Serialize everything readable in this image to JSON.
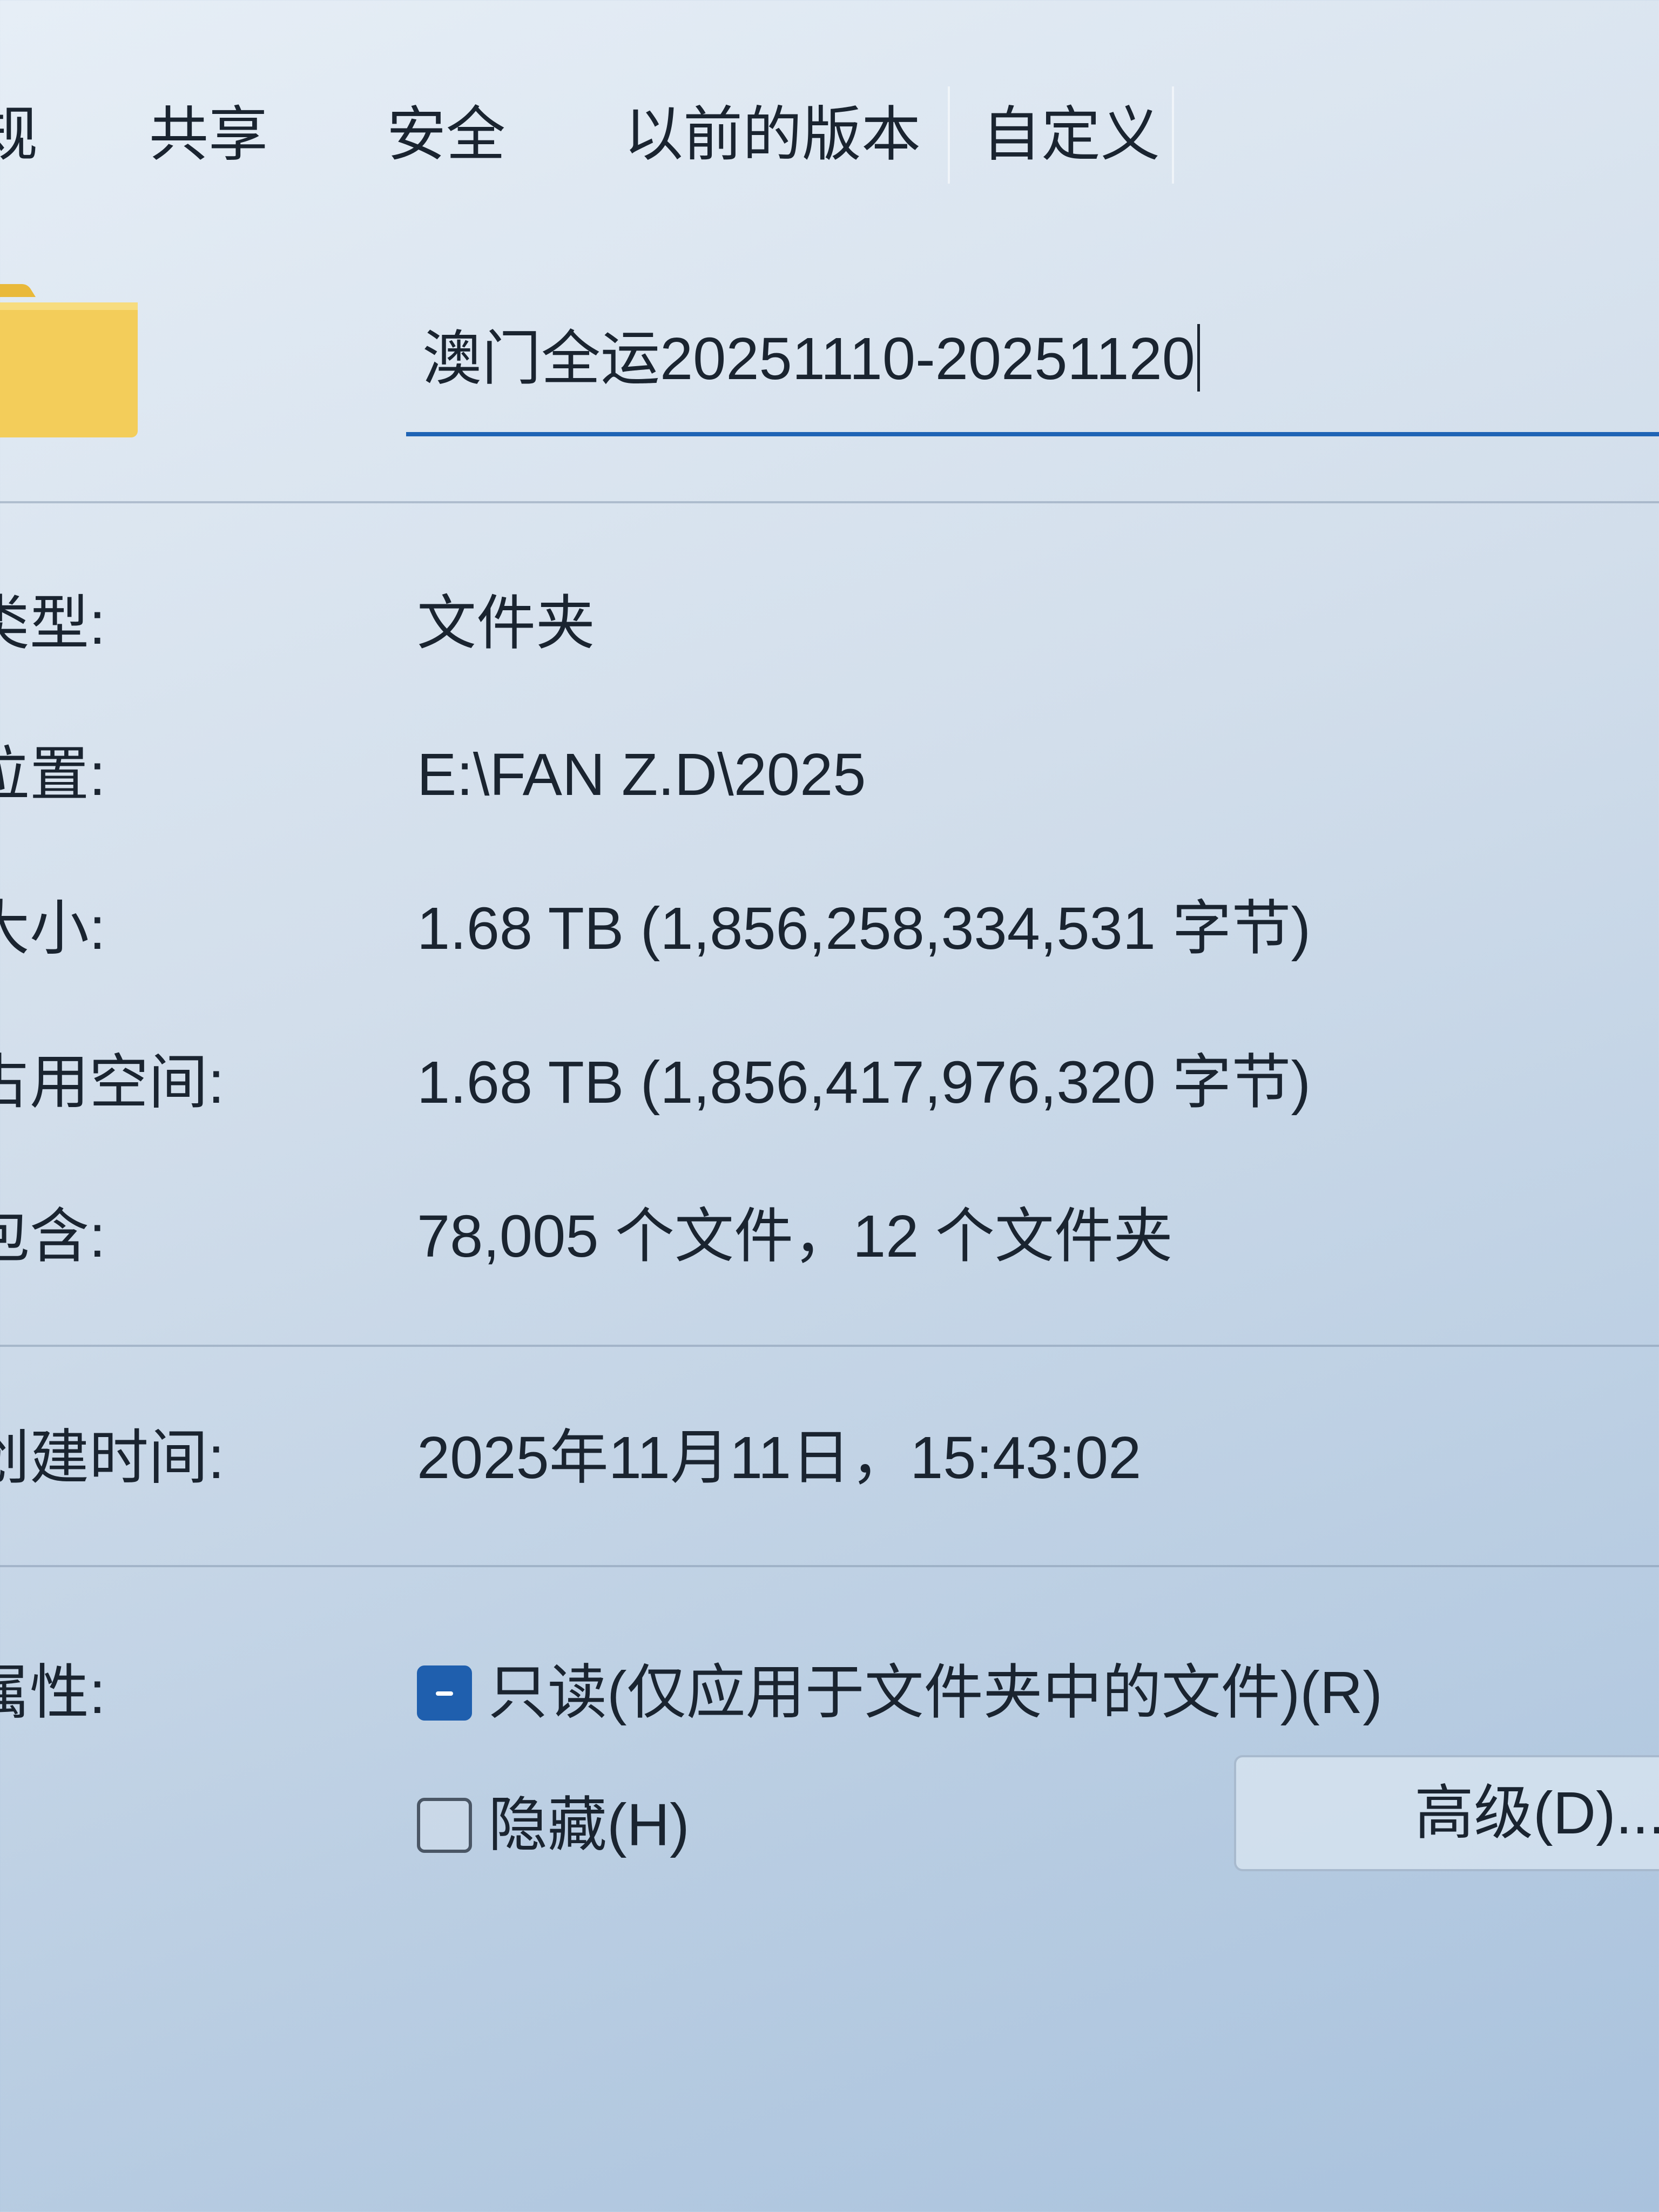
{
  "tabs": [
    {
      "label": "规"
    },
    {
      "label": "共享"
    },
    {
      "label": "安全"
    },
    {
      "label": "以前的版本"
    },
    {
      "label": "自定义"
    }
  ],
  "folder": {
    "name": "澳门全运20251110-20251120",
    "icon": "folder-icon",
    "icon_color": "#f3cd5a"
  },
  "properties": {
    "type": {
      "label": "类型:",
      "value": "文件夹"
    },
    "location": {
      "label": "位置:",
      "value": "E:\\FAN Z.D\\2025"
    },
    "size": {
      "label": "大小:",
      "value": "1.68 TB (1,856,258,334,531 字节)"
    },
    "size_on_disk": {
      "label": "占用空间:",
      "value": "1.68 TB (1,856,417,976,320 字节)"
    },
    "contains": {
      "label": "包含:",
      "value": "78,005 个文件，12 个文件夹"
    },
    "created": {
      "label": "创建时间:",
      "value": "2025年11月11日，15:43:02"
    }
  },
  "attributes": {
    "label": "属性:",
    "readonly": {
      "label": "只读(仅应用于文件夹中的文件)(R)",
      "state": "indeterminate"
    },
    "hidden": {
      "label": "隐藏(H)",
      "state": "unchecked"
    },
    "advanced_button": "高级(D)..."
  },
  "colors": {
    "accent": "#1f64b5",
    "checkbox_fill": "#1f5fae"
  }
}
